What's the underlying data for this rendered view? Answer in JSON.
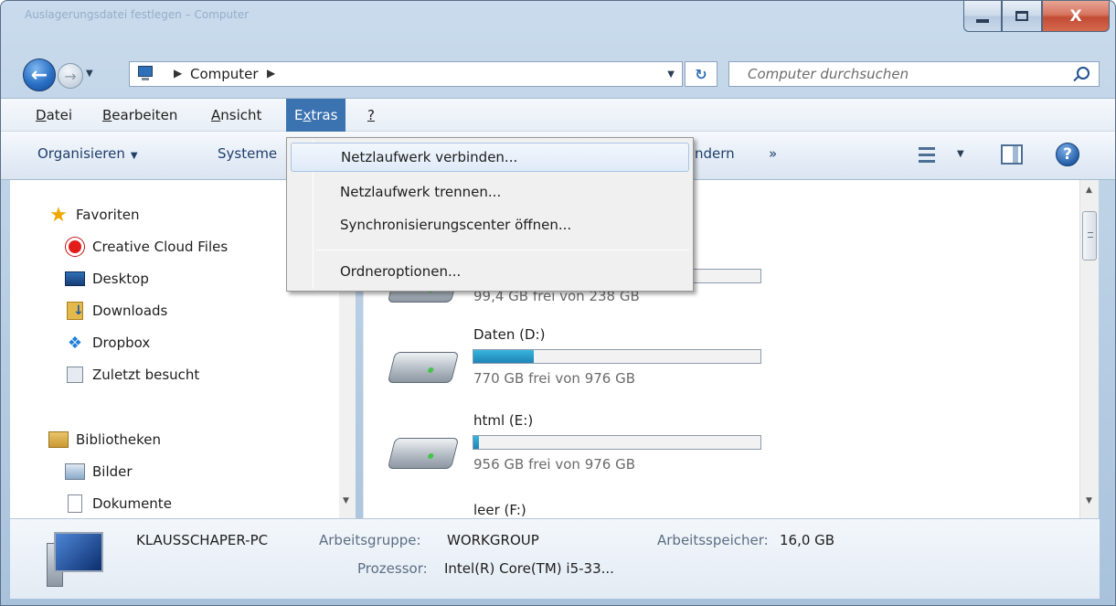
{
  "window": {
    "title": "Auslagerungsdatei festlegen – Computer",
    "controls": {
      "minimize": "Minimieren",
      "maximize": "Maximieren",
      "close_glyph": "X"
    }
  },
  "address": {
    "segments": [
      "Computer"
    ],
    "search_placeholder": "Computer durchsuchen"
  },
  "menubar": {
    "items": [
      {
        "label": "Datei",
        "accesskey": "D",
        "rest": "atei"
      },
      {
        "label": "Bearbeiten",
        "accesskey": "B",
        "rest": "earbeiten"
      },
      {
        "label": "Ansicht",
        "accesskey": "A",
        "rest": "nsicht"
      },
      {
        "label": "Extras",
        "accesskey": "x",
        "pre": "E",
        "rest": "tras",
        "active": true
      },
      {
        "label": "?",
        "accesskey": "?"
      }
    ]
  },
  "toolbar": {
    "organize": "Organisieren",
    "system": "Systeme",
    "uninstall": "ndern",
    "more": "»"
  },
  "extras_menu": {
    "items": [
      "Netzlaufwerk verbinden...",
      "Netzlaufwerk trennen...",
      "Synchronisierungscenter öffnen...",
      "Ordneroptionen..."
    ]
  },
  "nav": {
    "favorites": {
      "header": "Favoriten",
      "items": [
        "Creative Cloud Files",
        "Desktop",
        "Downloads",
        "Dropbox",
        "Zuletzt besucht"
      ]
    },
    "libraries": {
      "header": "Bibliotheken",
      "items": [
        "Bilder",
        "Dokumente"
      ]
    }
  },
  "drives": [
    {
      "name": "",
      "free": "99,4 GB frei von 238 GB",
      "used_fraction": 0.58
    },
    {
      "name": "Daten (D:)",
      "free": "770 GB frei von 976 GB",
      "used_fraction": 0.21
    },
    {
      "name": "html (E:)",
      "free": "956 GB frei von 976 GB",
      "used_fraction": 0.02
    },
    {
      "name": "leer (F:)",
      "free": "",
      "used_fraction": 0
    }
  ],
  "details": {
    "pc_name": "KLAUSSCHAPER-PC",
    "workgroup_label": "Arbeitsgruppe:",
    "workgroup_value": "WORKGROUP",
    "memory_label": "Arbeitsspeicher:",
    "memory_value": "16,0 GB",
    "cpu_label": "Prozessor:",
    "cpu_value": "Intel(R) Core(TM) i5-33..."
  },
  "colors": {
    "menu_active": "#3a73b0",
    "drive_fill": "#1d83b7",
    "frame": "#b7cde3"
  }
}
